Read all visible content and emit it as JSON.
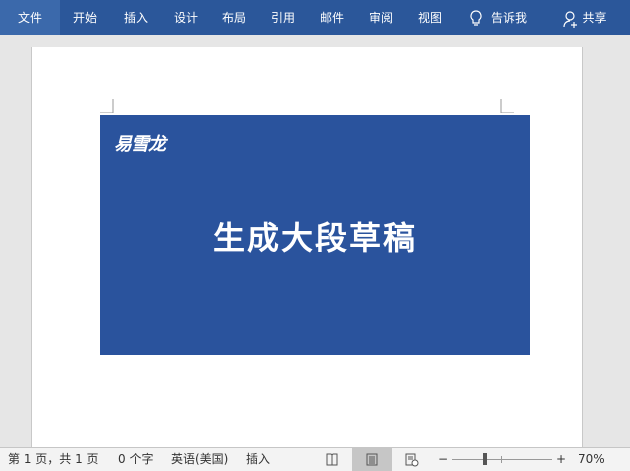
{
  "ribbon": {
    "tabs": [
      "文件",
      "开始",
      "插入",
      "设计",
      "布局",
      "引用",
      "邮件",
      "审阅",
      "视图"
    ],
    "tell_me": "告诉我",
    "share": "共享"
  },
  "document": {
    "logo": "易雪龙",
    "title": "生成大段草稿"
  },
  "status": {
    "page": "第 1 页，共 1 页",
    "words": "0 个字",
    "language": "英语(美国)",
    "mode": "插入",
    "zoom_minus": "−",
    "zoom_plus": "+",
    "zoom": "70%",
    "zoom_level": 0.7
  },
  "colors": {
    "ribbon": "#2b579a",
    "banner": "#2a539d"
  }
}
